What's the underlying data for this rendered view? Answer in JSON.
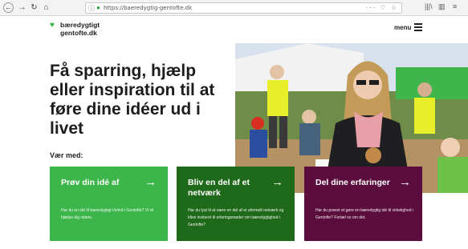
{
  "browser": {
    "url": "https://baeredygtig-gentofte.dk",
    "back_icon": "←",
    "forward_icon": "→",
    "reload_icon": "↻",
    "home_icon": "⌂",
    "info_icon": "ⓘ",
    "lock_icon": "🔒",
    "url_actions": "··· ♡ ☆",
    "library_icon": "|||\\",
    "sidebar_icon": "▥",
    "menu_icon": "≡"
  },
  "header": {
    "logo_line1": "bæredygtigt",
    "logo_line2": "gentofte.dk",
    "menu_label": "menu",
    "brand_color": "#2fb34a"
  },
  "hero": {
    "headline": "Få sparring, hjælp eller inspiration til at føre dine idéer ud i livet",
    "section_label": "Vær med:"
  },
  "cards": [
    {
      "title": "Prøv din idé af",
      "text": "Har du en idé til bæredygtigt i/e/ind i Gentofte? Vi vil hjælpe dig videre.",
      "color": "#3cb54a"
    },
    {
      "title": "Bliv en del af et netværk",
      "text": "Har du lyst til at være en del af et uformelt netværk og blive inviteret til erfaringsmøder om bæredygtighed i Gentofte?",
      "color": "#1f6a1a"
    },
    {
      "title": "Del dine erfaringer",
      "text": "Har du prøvet et gøre en bæredygtig idé til virkelighed i Gentofte? Fortæl os om det.",
      "color": "#5b0d3e"
    }
  ],
  "arrow_icon": "→"
}
